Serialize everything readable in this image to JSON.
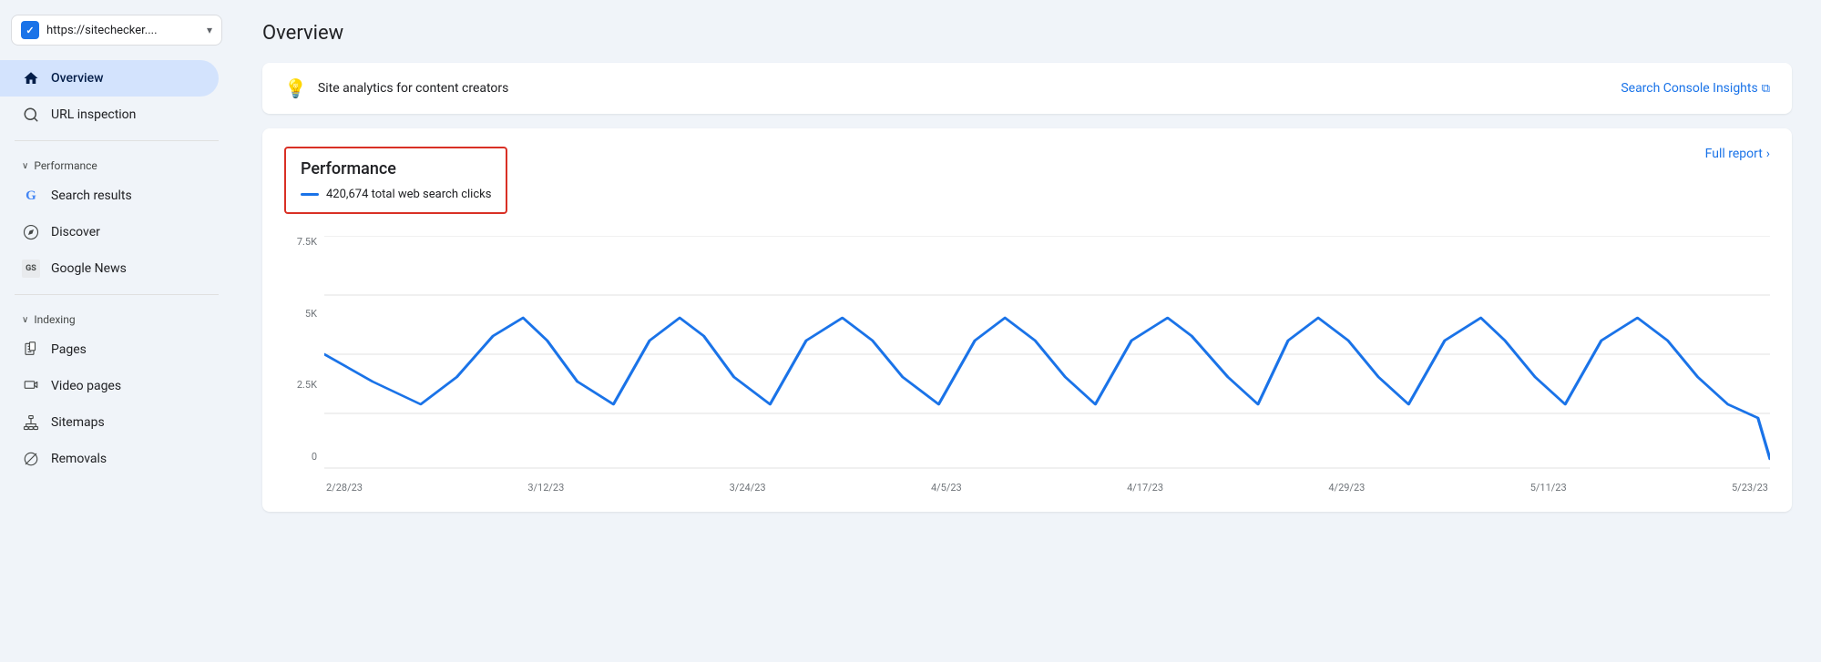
{
  "sidebar": {
    "url": "https://sitechecker....",
    "items": [
      {
        "id": "overview",
        "label": "Overview",
        "icon": "🏠",
        "active": true
      },
      {
        "id": "url-inspection",
        "label": "URL inspection",
        "icon": "🔍",
        "active": false
      }
    ],
    "sections": [
      {
        "label": "Performance",
        "items": [
          {
            "id": "search-results",
            "label": "Search results",
            "icon": "G",
            "active": false
          },
          {
            "id": "discover",
            "label": "Discover",
            "icon": "✳",
            "active": false
          },
          {
            "id": "google-news",
            "label": "Google News",
            "icon": "GN",
            "active": false
          }
        ]
      },
      {
        "label": "Indexing",
        "items": [
          {
            "id": "pages",
            "label": "Pages",
            "icon": "📄",
            "active": false
          },
          {
            "id": "video-pages",
            "label": "Video pages",
            "icon": "📋",
            "active": false
          },
          {
            "id": "sitemaps",
            "label": "Sitemaps",
            "icon": "🗺",
            "active": false
          },
          {
            "id": "removals",
            "label": "Removals",
            "icon": "🚫",
            "active": false
          }
        ]
      }
    ]
  },
  "header": {
    "title": "Overview"
  },
  "banner": {
    "text": "Site analytics for content creators",
    "link_label": "Search Console Insights",
    "link_icon": "↗"
  },
  "performance": {
    "title": "Performance",
    "stat": "420,674 total web search clicks",
    "full_report_label": "Full report",
    "full_report_icon": "›"
  },
  "chart": {
    "y_labels": [
      "7.5K",
      "5K",
      "2.5K",
      "0"
    ],
    "x_labels": [
      "2/28/23",
      "3/12/23",
      "3/24/23",
      "4/5/23",
      "4/17/23",
      "4/29/23",
      "5/11/23",
      "5/23/23"
    ]
  },
  "icons": {
    "home": "⌂",
    "search": "🔍",
    "bulb": "💡",
    "external": "⧉",
    "chevron_right": "›",
    "chevron_down": "∨"
  }
}
